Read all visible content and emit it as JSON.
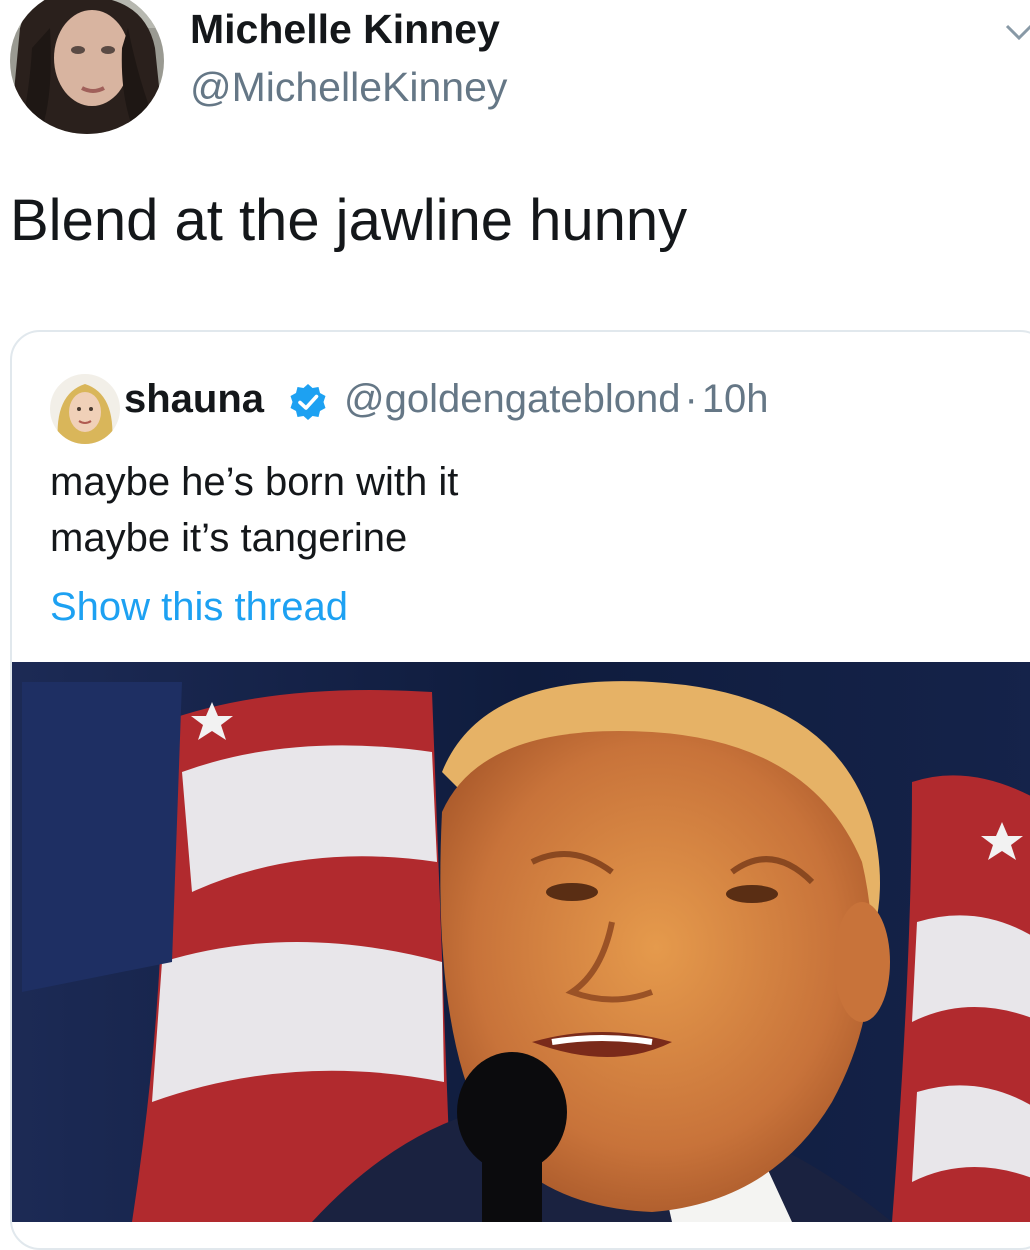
{
  "tweet": {
    "author": {
      "name": "Michelle Kinney",
      "handle": "@MichelleKinney"
    },
    "text": "Blend at the jawline hunny"
  },
  "quoted_tweet": {
    "author": {
      "name": "shauna",
      "handle": "@goldengateblond",
      "time": "10h",
      "separator": "·"
    },
    "lines": [
      "maybe he’s born with it",
      "maybe it’s tangerine"
    ],
    "show_thread_label": "Show this thread"
  },
  "icons": {
    "verified": "verified-badge-icon",
    "menu": "chevron-down-icon"
  },
  "colors": {
    "link": "#1da1f2",
    "secondary_text": "#657786",
    "primary_text": "#14171a",
    "border": "#e1e8ed"
  }
}
